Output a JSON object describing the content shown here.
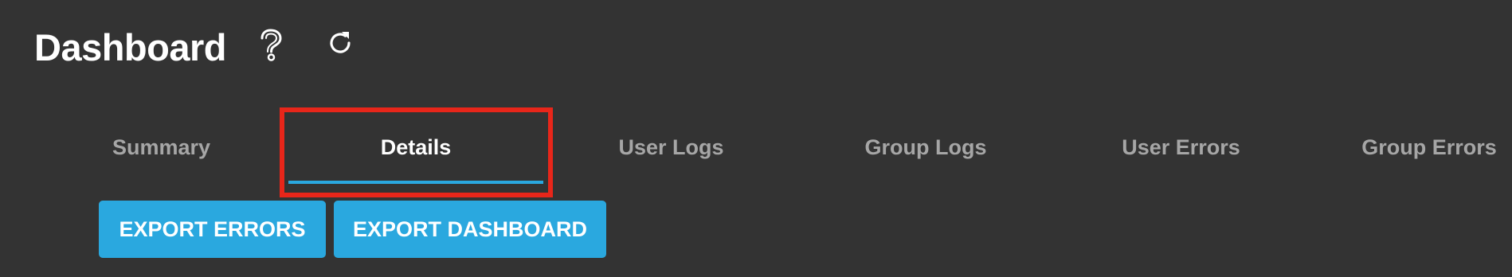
{
  "header": {
    "title": "Dashboard",
    "help_icon": "help-circle-icon",
    "refresh_icon": "refresh-icon"
  },
  "tabs": [
    {
      "label": "Summary",
      "active": false
    },
    {
      "label": "Details",
      "active": true
    },
    {
      "label": "User Logs",
      "active": false
    },
    {
      "label": "Group Logs",
      "active": false
    },
    {
      "label": "User Errors",
      "active": false
    },
    {
      "label": "Group Errors",
      "active": false
    }
  ],
  "actions": {
    "export_errors_label": "EXPORT ERRORS",
    "export_dashboard_label": "EXPORT DASHBOARD"
  },
  "colors": {
    "background": "#333333",
    "accent": "#2aa8df",
    "highlight": "#e8261a",
    "inactive_tab": "#a6a6a6"
  }
}
